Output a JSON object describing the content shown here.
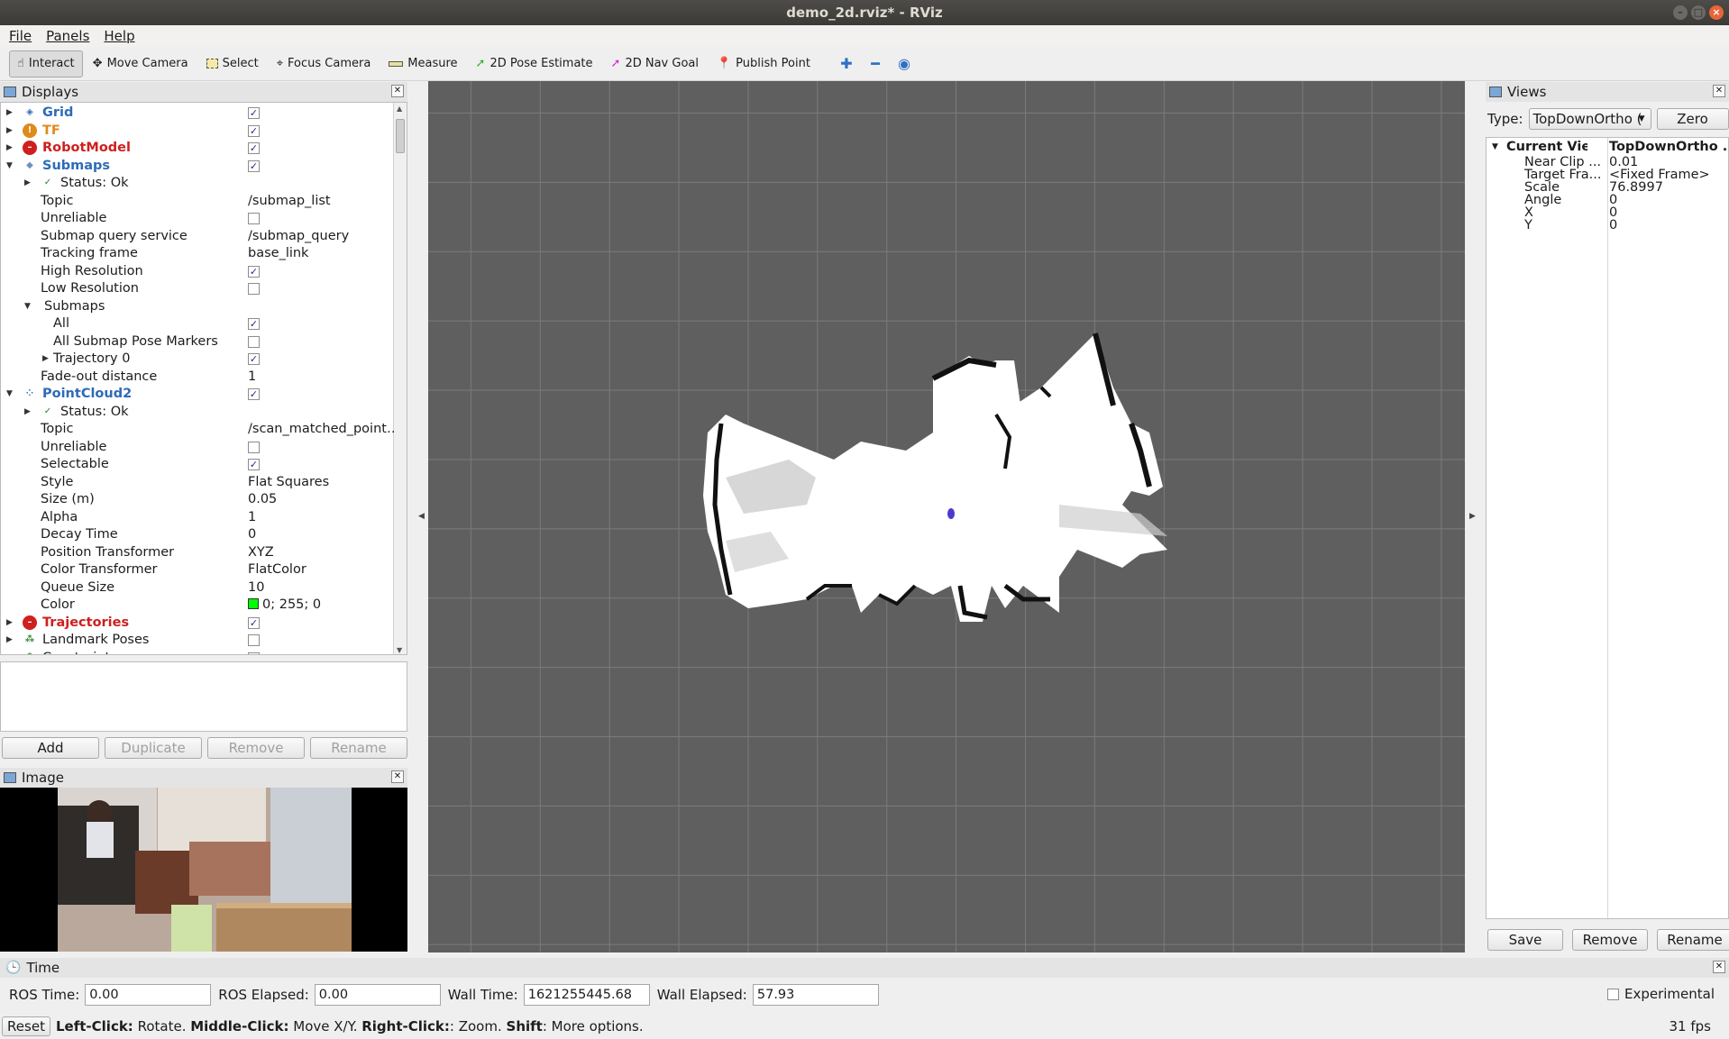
{
  "window": {
    "title": "demo_2d.rviz* - RViz"
  },
  "menu": [
    "File",
    "Panels",
    "Help"
  ],
  "toolbar": {
    "tools": [
      "Interact",
      "Move Camera",
      "Select",
      "Focus Camera",
      "Measure",
      "2D Pose Estimate",
      "2D Nav Goal",
      "Publish Point"
    ],
    "active_tool": "Interact"
  },
  "displays": {
    "title": "Displays",
    "rows": [
      {
        "label": "Grid",
        "value": "",
        "check": "✓"
      },
      {
        "label": "TF",
        "value": "",
        "check": "✓"
      },
      {
        "label": "RobotModel",
        "value": "",
        "check": "✓"
      },
      {
        "label": "Submaps",
        "value": "",
        "check": "✓"
      },
      {
        "label": "Status: Ok",
        "value": "",
        "check": ""
      },
      {
        "label": "Topic",
        "value": "/submap_list",
        "check": ""
      },
      {
        "label": "Unreliable",
        "value": "",
        "check": " "
      },
      {
        "label": "Submap query service",
        "value": "/submap_query",
        "check": ""
      },
      {
        "label": "Tracking frame",
        "value": "base_link",
        "check": ""
      },
      {
        "label": "High Resolution",
        "value": "",
        "check": "✓"
      },
      {
        "label": "Low Resolution",
        "value": "",
        "check": " "
      },
      {
        "label": "Submaps",
        "value": "",
        "check": ""
      },
      {
        "label": "All",
        "value": "",
        "check": "✓"
      },
      {
        "label": "All Submap Pose Markers",
        "value": "",
        "check": " "
      },
      {
        "label": "Trajectory 0",
        "value": "",
        "check": "✓"
      },
      {
        "label": "Fade-out distance",
        "value": "1",
        "check": ""
      },
      {
        "label": "PointCloud2",
        "value": "",
        "check": "✓"
      },
      {
        "label": "Status: Ok",
        "value": "",
        "check": ""
      },
      {
        "label": "Topic",
        "value": "/scan_matched_point…",
        "check": ""
      },
      {
        "label": "Unreliable",
        "value": "",
        "check": " "
      },
      {
        "label": "Selectable",
        "value": "",
        "check": "✓"
      },
      {
        "label": "Style",
        "value": "Flat Squares",
        "check": ""
      },
      {
        "label": "Size (m)",
        "value": "0.05",
        "check": ""
      },
      {
        "label": "Alpha",
        "value": "1",
        "check": ""
      },
      {
        "label": "Decay Time",
        "value": "0",
        "check": ""
      },
      {
        "label": "Position Transformer",
        "value": "XYZ",
        "check": ""
      },
      {
        "label": "Color Transformer",
        "value": "FlatColor",
        "check": ""
      },
      {
        "label": "Queue Size",
        "value": "10",
        "check": ""
      },
      {
        "label": "Color",
        "value": "0; 255; 0",
        "check": ""
      },
      {
        "label": "Trajectories",
        "value": "",
        "check": "✓"
      },
      {
        "label": "Landmark Poses",
        "value": "",
        "check": " "
      },
      {
        "label": "Constraints",
        "value": "",
        "check": " "
      }
    ],
    "buttons": [
      "Add",
      "Duplicate",
      "Remove",
      "Rename"
    ]
  },
  "image_panel": {
    "title": "Image"
  },
  "views": {
    "title": "Views",
    "type_label": "Type:",
    "type_value": "TopDownOrtho (",
    "zero_label": "Zero",
    "current_view_key": "Current View",
    "current_view_value": "TopDownOrtho ...",
    "props": [
      {
        "k": "Near Clip ...",
        "v": "0.01"
      },
      {
        "k": "Target Fra...",
        "v": "<Fixed Frame>"
      },
      {
        "k": "Scale",
        "v": "76.8997"
      },
      {
        "k": "Angle",
        "v": "0"
      },
      {
        "k": "X",
        "v": "0"
      },
      {
        "k": "Y",
        "v": "0"
      }
    ],
    "buttons": [
      "Save",
      "Remove",
      "Rename"
    ]
  },
  "time": {
    "title": "Time",
    "ros_time_label": "ROS Time:",
    "ros_time": "0.00",
    "ros_elapsed_label": "ROS Elapsed:",
    "ros_elapsed": "0.00",
    "wall_time_label": "Wall Time:",
    "wall_time": "1621255445.68",
    "wall_elapsed_label": "Wall Elapsed:",
    "wall_elapsed": "57.93",
    "experimental_label": "Experimental"
  },
  "status": {
    "reset_label": "Reset",
    "hint_parts": [
      "Left-Click:",
      " Rotate. ",
      "Middle-Click:",
      " Move X/Y. ",
      "Right-Click:",
      ": Zoom. ",
      "Shift",
      ": More options."
    ],
    "fps": "31 fps"
  },
  "colors": {
    "grid_color": "#7b7b7b",
    "viewport_bg": "#5f5f5f",
    "pointcloud_color": "#00ff00"
  }
}
